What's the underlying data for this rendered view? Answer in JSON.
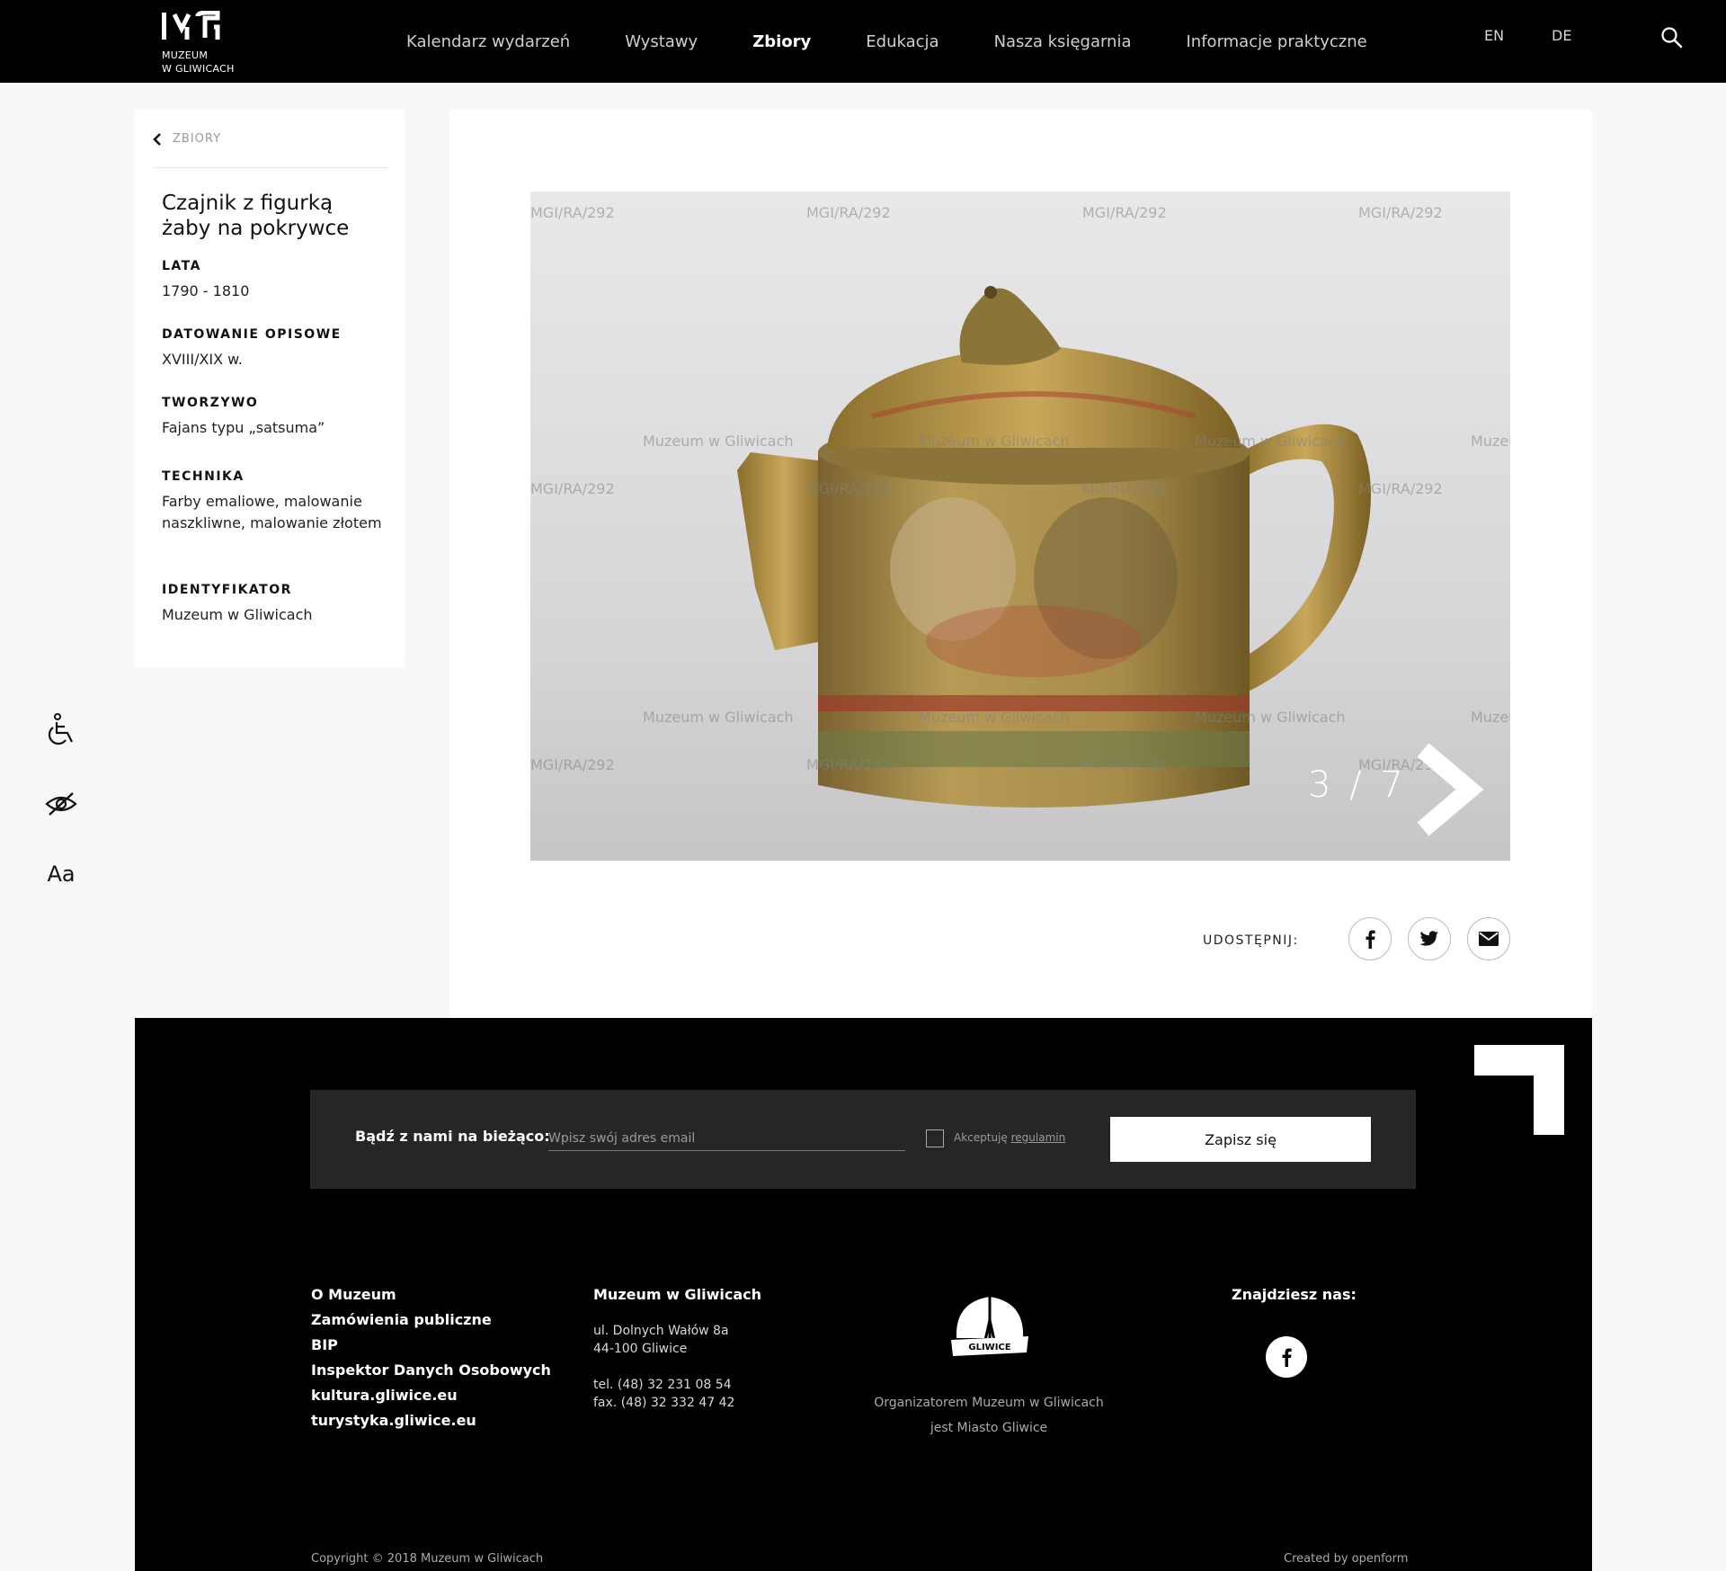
{
  "header": {
    "logo_text_line1": "MUZEUM",
    "logo_text_line2": "W GLIWICACH",
    "nav": [
      {
        "label": "Kalendarz wydarzeń",
        "active": false
      },
      {
        "label": "Wystawy",
        "active": false
      },
      {
        "label": "Zbiory",
        "active": true
      },
      {
        "label": "Edukacja",
        "active": false
      },
      {
        "label": "Nasza księgarnia",
        "active": false
      },
      {
        "label": "Informacje praktyczne",
        "active": false
      }
    ],
    "lang_en": "EN",
    "lang_de": "DE",
    "search_icon": "search-icon"
  },
  "object": {
    "back_label": "ZBIORY",
    "title": "Czajnik z figurką żaby na pokrywce",
    "fields": [
      {
        "label": "LATA",
        "value": "1790 - 1810"
      },
      {
        "label": "DATOWANIE OPISOWE",
        "value": "XVIII/XIX w."
      },
      {
        "label": "TWORZYWO",
        "value": "Fajans typu „satsuma”"
      },
      {
        "label": "TECHNIKA",
        "value": "Farby emaliowe, malowanie naszkliwne, malowanie złotem"
      },
      {
        "label": "IDENTYFIKATOR",
        "value": "Muzeum w Gliwicach"
      }
    ]
  },
  "accessibility": {
    "wheelchair_icon": "wheelchair-icon",
    "contrast_icon": "eye-slash-icon",
    "font_size_label": "Aa"
  },
  "gallery": {
    "counter": "3 / 7",
    "watermark_code": "MGI/RA/292",
    "watermark_name": "Muzeum w Gliwicach"
  },
  "share": {
    "label": "UDOSTĘPNIJ:",
    "icons": [
      "facebook-icon",
      "twitter-icon",
      "email-icon"
    ]
  },
  "newsletter": {
    "label": "Bądź z nami na bieżąco:",
    "placeholder": "Wpisz swój adres email",
    "checkbox_prefix": "Akceptuję ",
    "checkbox_link": "regulamin",
    "submit_label": "Zapisz się"
  },
  "footer": {
    "links": [
      "O Muzeum",
      "Zamówienia publiczne",
      "BIP",
      "Inspektor Danych Osobowych",
      "kultura.gliwice.eu",
      "turystyka.gliwice.eu"
    ],
    "museum_title": "Muzeum w Gliwicach",
    "address_line1": "ul. Dolnych Wałów 8a",
    "address_line2": "44-100 Gliwice",
    "phone": "tel. (48) 32 231 08 54",
    "fax": "fax. (48) 32 332 47 42",
    "city_logo_text": "GLIWICE",
    "organizer_line1": "Organizatorem Muzeum w Gliwicach",
    "organizer_line2": "jest Miasto Gliwice",
    "find_us": "Znajdziesz nas:",
    "copyright": "Copyright © 2018 Muzeum w Gliwicach",
    "created_by": "Created by openform"
  }
}
